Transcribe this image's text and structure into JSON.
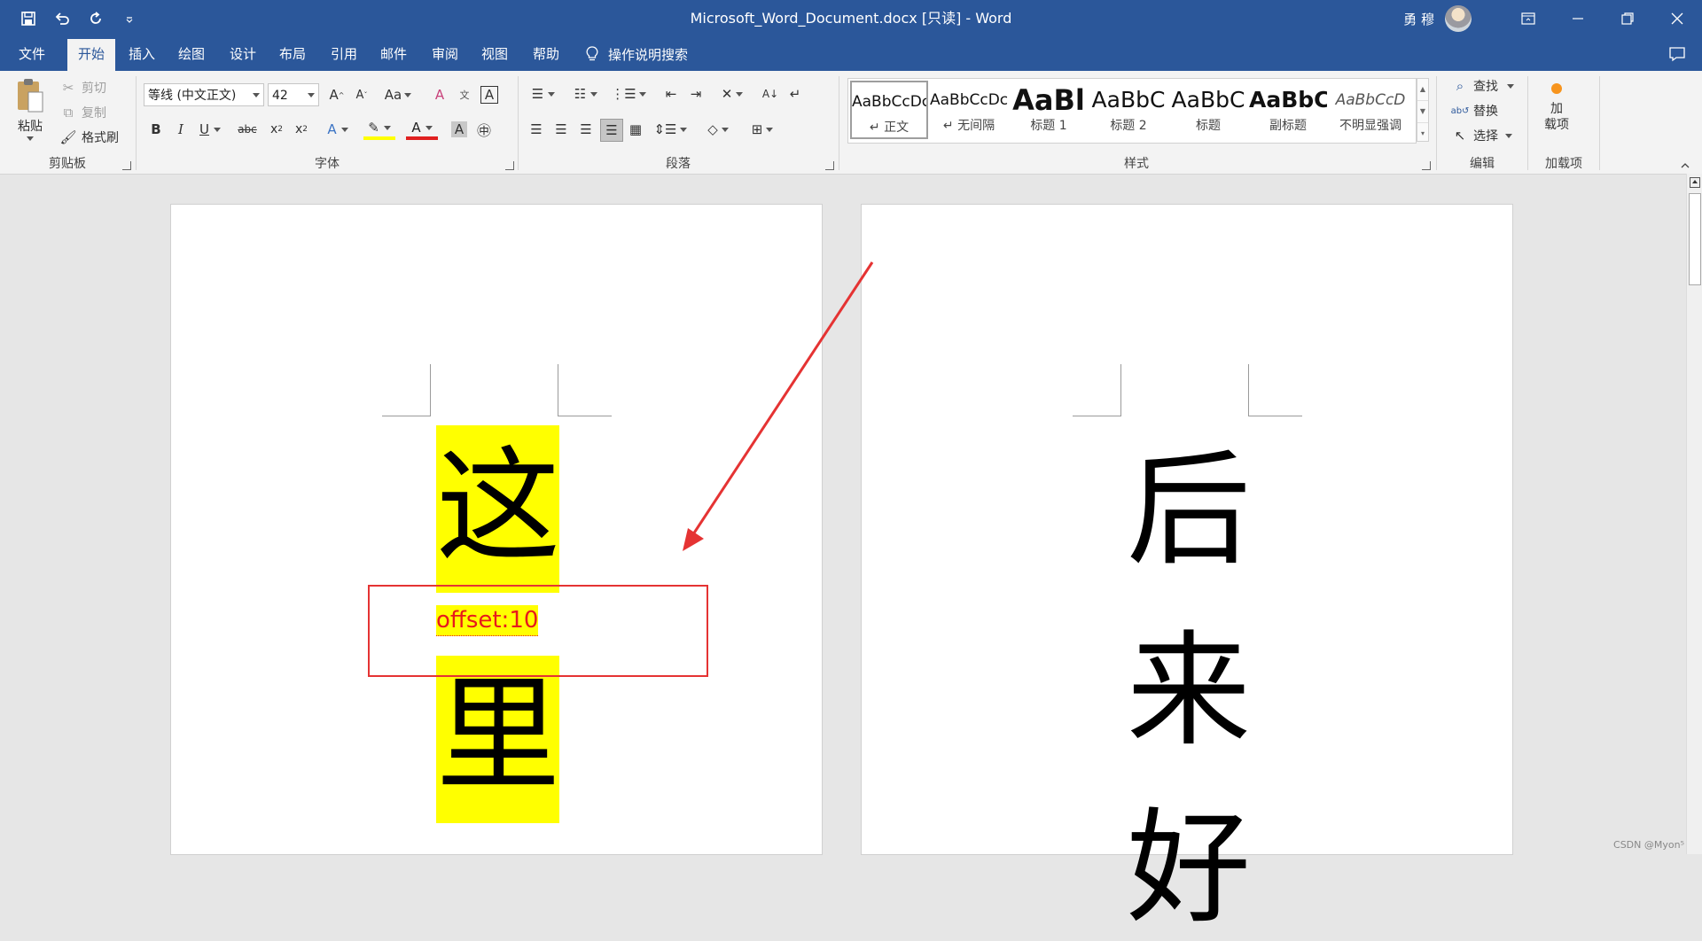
{
  "title_bar": {
    "title": "Microsoft_Word_Document.docx [只读]  -  Word",
    "user_name": "勇 穆"
  },
  "tabs": [
    {
      "label": "文件"
    },
    {
      "label": "开始"
    },
    {
      "label": "插入"
    },
    {
      "label": "绘图"
    },
    {
      "label": "设计"
    },
    {
      "label": "布局"
    },
    {
      "label": "引用"
    },
    {
      "label": "邮件"
    },
    {
      "label": "审阅"
    },
    {
      "label": "视图"
    },
    {
      "label": "帮助"
    }
  ],
  "active_tab": "开始",
  "tell_me": "操作说明搜索",
  "clipboard": {
    "paste": "粘贴",
    "cut": "剪切",
    "copy": "复制",
    "format_painter": "格式刷",
    "label": "剪贴板"
  },
  "font": {
    "font_name": "等线 (中文正文)",
    "font_size": "42",
    "label": "字体"
  },
  "paragraph": {
    "label": "段落"
  },
  "styles": {
    "items": [
      {
        "sample": "AaBbCcDc",
        "name": "↵ 正文"
      },
      {
        "sample": "AaBbCcDc",
        "name": "↵ 无间隔"
      },
      {
        "sample": "AaBl",
        "name": "标题 1"
      },
      {
        "sample": "AaBbC",
        "name": "标题 2"
      },
      {
        "sample": "AaBbC",
        "name": "标题"
      },
      {
        "sample": "AaBbC",
        "name": "副标题"
      },
      {
        "sample": "AaBbCcD",
        "name": "不明显强调"
      }
    ],
    "label": "样式"
  },
  "editing": {
    "find": "查找",
    "replace": "替换",
    "select": "选择",
    "label": "编辑"
  },
  "addins": {
    "button": "加\n载项",
    "label": "加载项"
  },
  "document": {
    "page1": {
      "char1": "这",
      "offset_annotation": "offset:10",
      "char2": "里"
    },
    "page2": {
      "char1": "后",
      "char2": "来",
      "char3": "好"
    }
  },
  "watermark": "CSDN @Myon⁵",
  "colors": {
    "title_bar": "#2b579a",
    "ribbon": "#f3f3f3",
    "highlight": "#ffff00",
    "annotation_red": "#e53333"
  }
}
